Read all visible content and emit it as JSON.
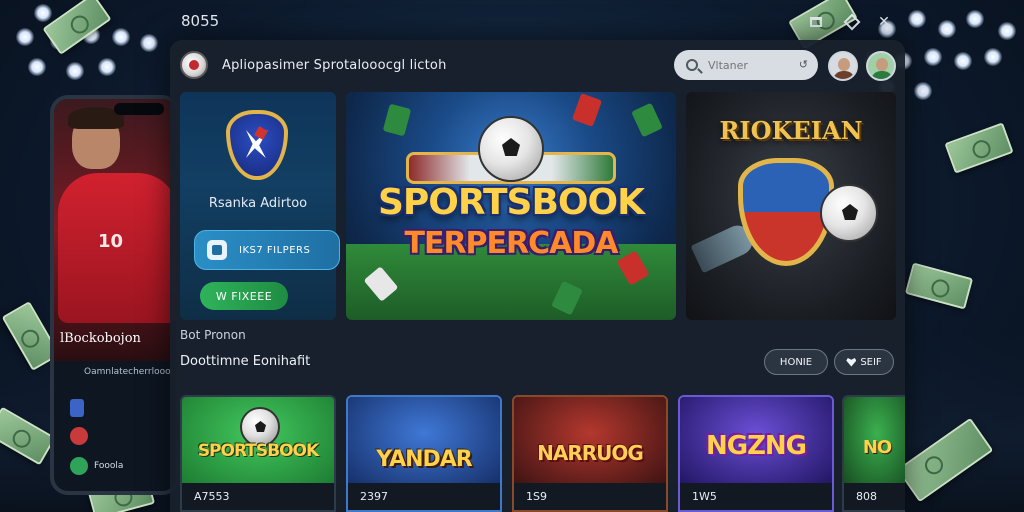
{
  "window": {
    "number": "8055",
    "app_title": "Apliopasimer Sprotalooocgl lictoh",
    "search_placeholder": "Vltaner"
  },
  "side_panel": {
    "label": "Rsanka Adirtoo",
    "blue_button": "IKS7 FILPERS",
    "green_button": "W FIXEEE"
  },
  "hero": {
    "title": "SPORTSBOOK",
    "subtitle": "TERPERCADA"
  },
  "promo": {
    "title": "RIOKEIAN"
  },
  "sections": {
    "small_label": "Bot Pronon",
    "title": "Doottimne Eonihafit",
    "chip_home": "HONIE",
    "chip_fav": "SEIF"
  },
  "games": [
    {
      "title": "SPORTSBOOK",
      "value": "A7553",
      "color": "#2ea346"
    },
    {
      "title": "YANDAR",
      "value": "2397",
      "color": "#2b5ab8"
    },
    {
      "title": "NARRUOG",
      "value": "1S9",
      "color": "#8a2a2a"
    },
    {
      "title": "NGZNG",
      "value": "1W5",
      "color": "#3b2e9c"
    },
    {
      "title": "NO",
      "value": "808",
      "color": "#2e7a3c"
    }
  ],
  "phone": {
    "title": "lBockobojon",
    "subtitle": "Oamnlatecherrlooo",
    "row_label": "Fooola",
    "jersey_number": "10"
  },
  "colors": {
    "background": "#0d1b2e",
    "window": "#18202c",
    "accent_blue": "#2a8fc6",
    "accent_green": "#2fb35a",
    "gold": "#ffd24a"
  }
}
